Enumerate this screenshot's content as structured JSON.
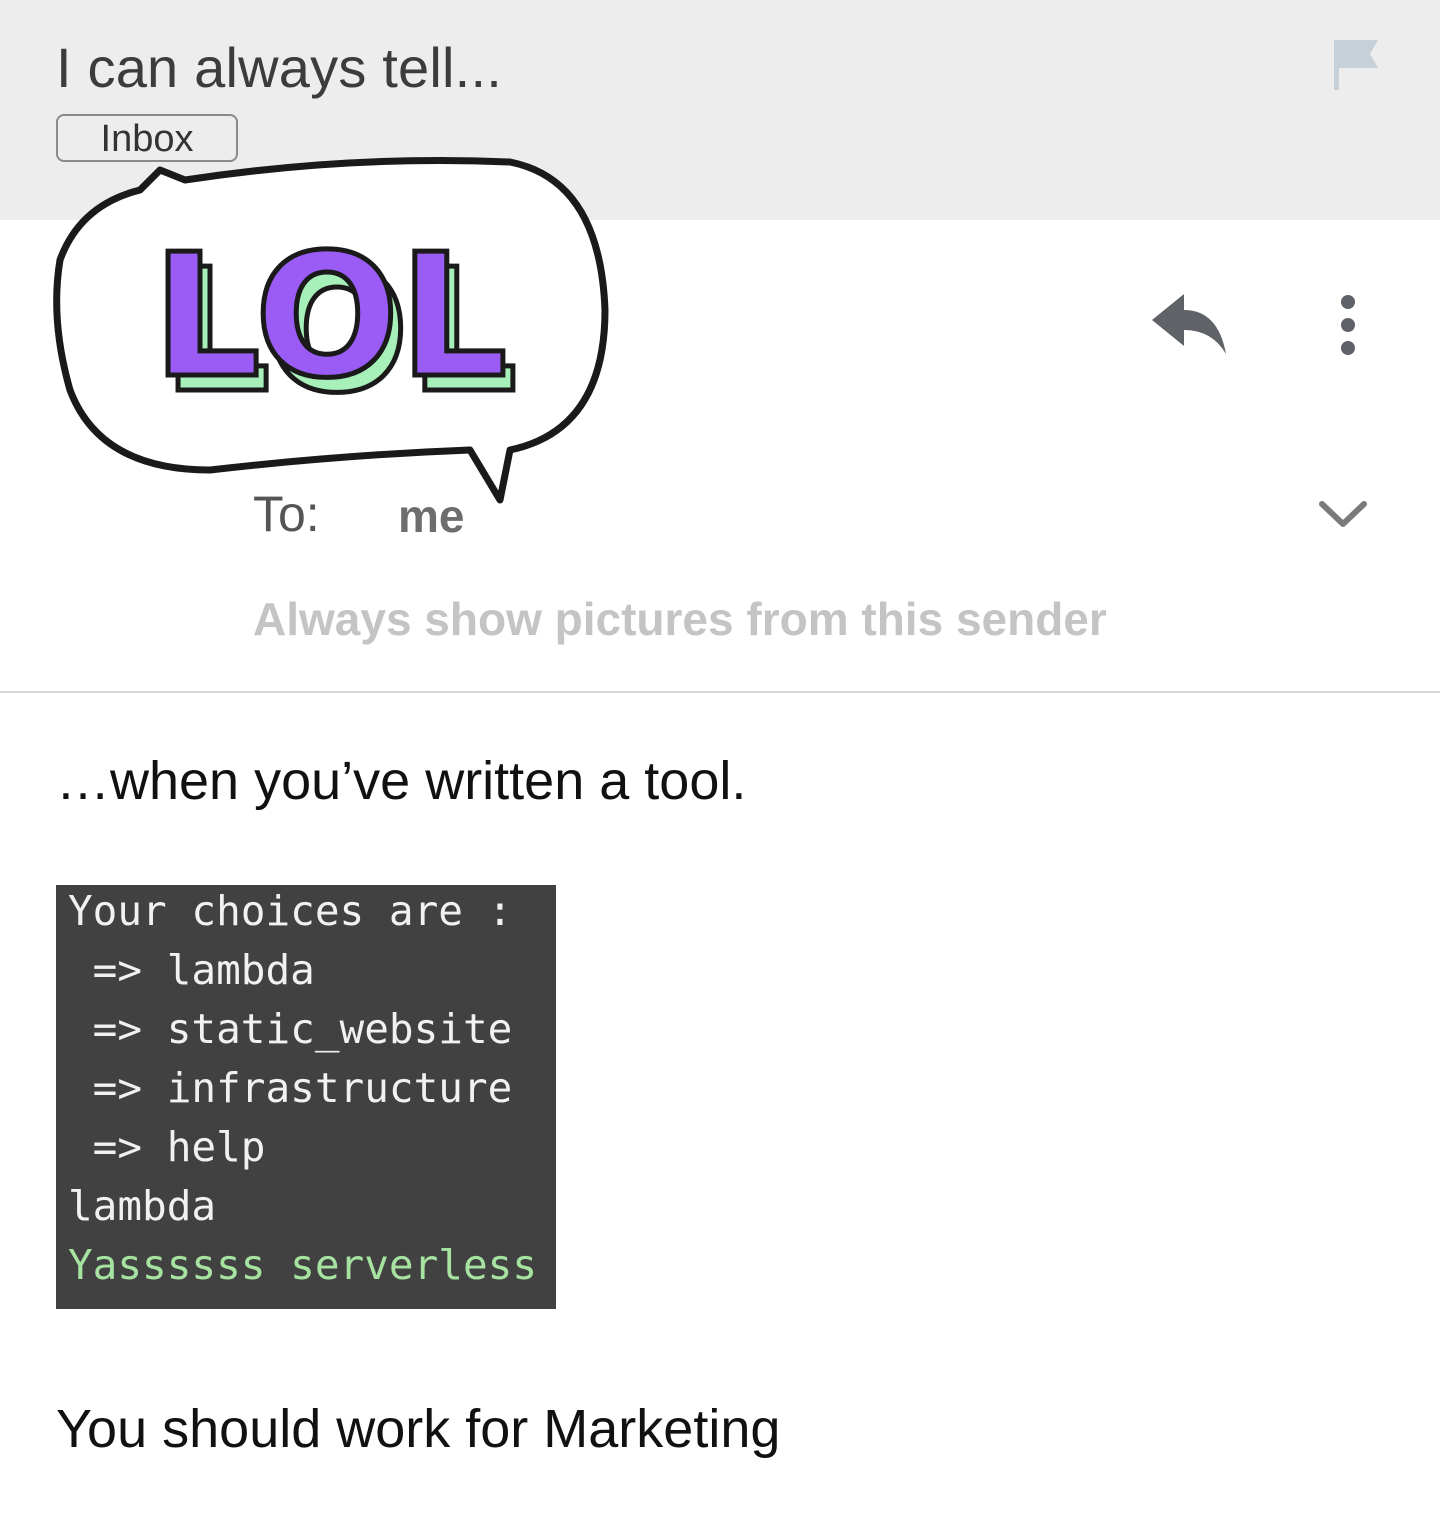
{
  "header": {
    "subject": "I can always tell...",
    "label": "Inbox",
    "flag_icon": "flag-icon"
  },
  "sticker": {
    "text": "LOL",
    "colors": {
      "letters": "#9b5cf6",
      "shadow": "#a7f0b9",
      "outline": "#1a1a1a"
    }
  },
  "actions": {
    "reply_icon": "reply-icon",
    "more_icon": "more-vert-icon"
  },
  "recipient": {
    "label": "To:",
    "value": "me",
    "expand_icon": "chevron-down-icon"
  },
  "show_pictures": "Always show pictures from this sender",
  "body": {
    "line1": "…when you’ve written a tool.",
    "terminal": {
      "lines": [
        "Your choices are :",
        " => lambda",
        " => static_website",
        " => infrastructure",
        " => help",
        "lambda",
        "Yassssss serverless"
      ],
      "highlight_color": "#a6e3a1",
      "background": "#414141"
    },
    "line2": "You should work for Marketing"
  }
}
